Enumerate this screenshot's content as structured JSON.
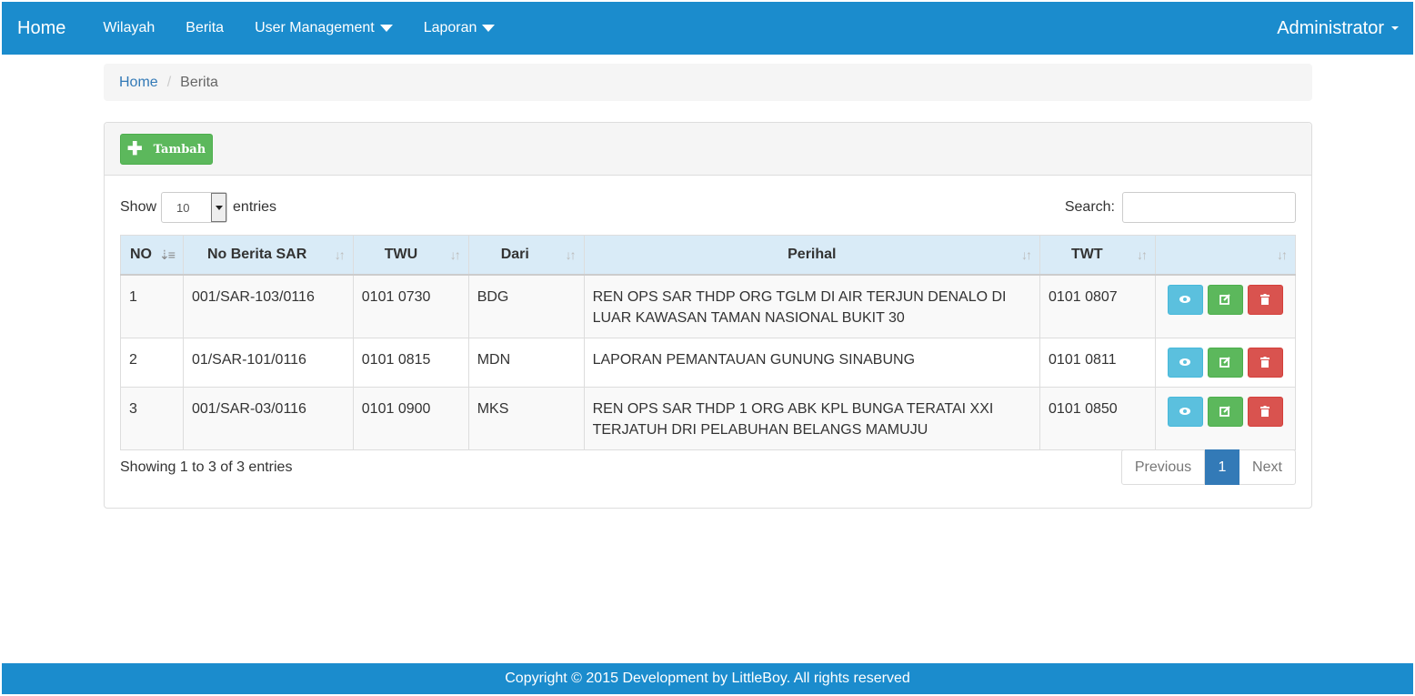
{
  "navbar": {
    "brand": "Home",
    "items": [
      {
        "label": "Wilayah",
        "dropdown": false
      },
      {
        "label": "Berita",
        "dropdown": false
      },
      {
        "label": "User Management",
        "dropdown": true
      },
      {
        "label": "Laporan",
        "dropdown": true
      }
    ],
    "user": "Administrator"
  },
  "breadcrumb": {
    "home": "Home",
    "separator": "/",
    "current": "Berita"
  },
  "panel": {
    "add_label": "Tambah"
  },
  "table_controls": {
    "show_label": "Show",
    "entries_value": "10",
    "entries_label": "entries",
    "search_label": "Search:",
    "search_value": ""
  },
  "table": {
    "headers": [
      "NO",
      "No Berita SAR",
      "TWU",
      "Dari",
      "Perihal",
      "TWT",
      ""
    ],
    "rows": [
      {
        "no": "1",
        "no_berita": "001/SAR-103/0116",
        "twu": "0101 0730",
        "dari": "BDG",
        "perihal": "REN OPS SAR THDP ORG TGLM DI AIR TERJUN DENALO DI LUAR KAWASAN TAMAN NASIONAL BUKIT 30",
        "twt": "0101 0807"
      },
      {
        "no": "2",
        "no_berita": "01/SAR-101/0116",
        "twu": "0101 0815",
        "dari": "MDN",
        "perihal": "LAPORAN PEMANTAUAN GUNUNG SINABUNG",
        "twt": "0101 0811"
      },
      {
        "no": "3",
        "no_berita": "001/SAR-03/0116",
        "twu": "0101 0900",
        "dari": "MKS",
        "perihal": "REN OPS SAR THDP 1 ORG ABK KPL BUNGA TERATAI XXI TERJATUH DRI PELABUHAN BELANGS MAMUJU",
        "twt": "0101 0850"
      }
    ]
  },
  "pagination": {
    "info": "Showing 1 to 3 of 3 entries",
    "previous": "Previous",
    "current": "1",
    "next": "Next"
  },
  "footer": {
    "text": "Copyright © 2015 Development by LittleBoy. All rights reserved"
  },
  "colors": {
    "navbar": "#1b8ccd",
    "view": "#5bc0de",
    "edit": "#5cb85c",
    "delete": "#d9534f",
    "active_page": "#337ab7"
  }
}
